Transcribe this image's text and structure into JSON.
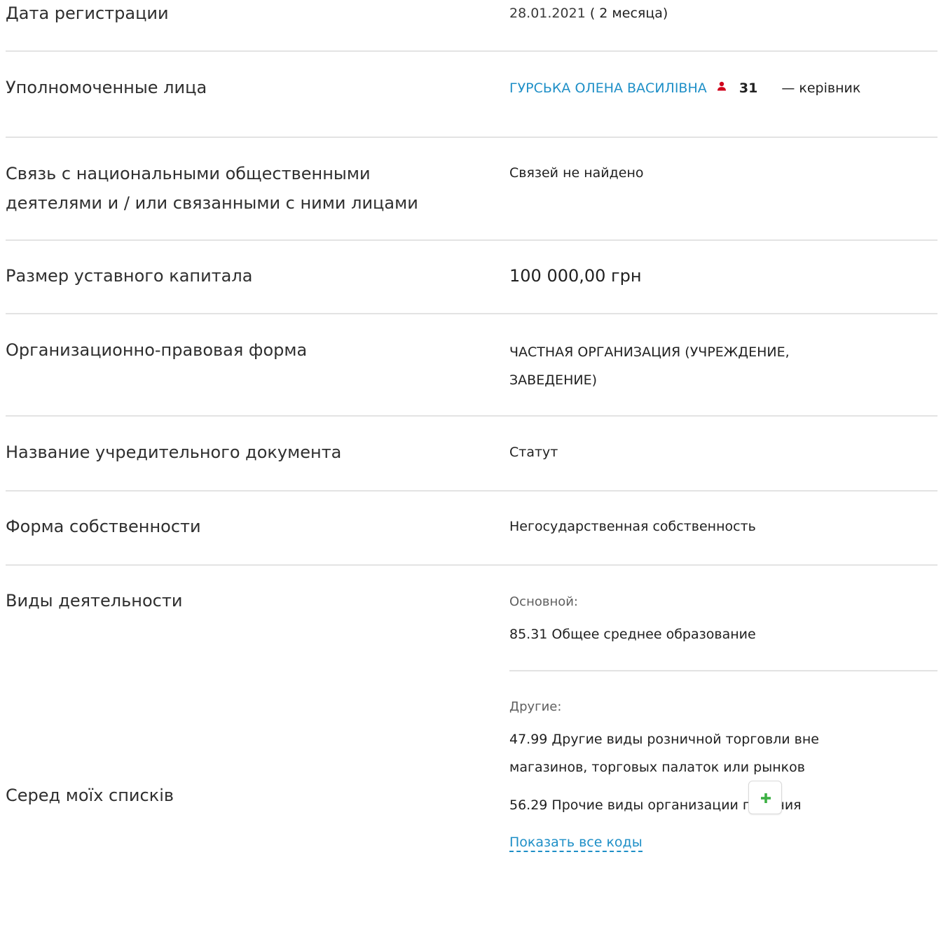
{
  "rows": {
    "registration": {
      "label": "Дата регистрации",
      "date": "28.01.2021",
      "duration": "( 2 месяца)"
    },
    "authorized": {
      "label": "Уполномоченные лица",
      "name": "ГУРСЬКА ОЛЕНА ВАСИЛІВНА",
      "count": "31",
      "role": "— керівник",
      "icon": "person-icon",
      "icon_color": "#d0021b"
    },
    "pep": {
      "label_line1": "Связь с национальными общественными",
      "label_line2": "деятелями и / или связанными с ними лицами",
      "value": "Связей не найдено"
    },
    "capital": {
      "label": "Размер уставного капитала",
      "value": "100 000,00 грн"
    },
    "legal_form": {
      "label": "Организационно-правовая форма",
      "value_line1": "ЧАСТНАЯ ОРГАНИЗАЦИЯ (УЧРЕЖДЕНИЕ,",
      "value_line2": "ЗАВЕДЕНИЕ)"
    },
    "founding_doc": {
      "label": "Название учредительного документа",
      "value": "Статут"
    },
    "ownership": {
      "label": "Форма собственности",
      "value": "Негосударственная собственность"
    },
    "activities": {
      "label": "Виды деятельности",
      "main_heading": "Основной:",
      "main_item": "85.31 Общее среднее образование",
      "other_heading": "Другие:",
      "other_item1_line1": "47.99 Другие виды розничной торговли вне",
      "other_item1_line2": "магазинов, торговых палаток или рынков",
      "other_item2": "56.29 Прочие виды организации питания",
      "show_all": "Показать все коды"
    },
    "lists": {
      "label": "Серед моїх списків",
      "add_icon": "plus-icon",
      "add_color": "#3cb043"
    }
  },
  "colors": {
    "link": "#1e8fc7",
    "divider": "#e3e3e3"
  }
}
